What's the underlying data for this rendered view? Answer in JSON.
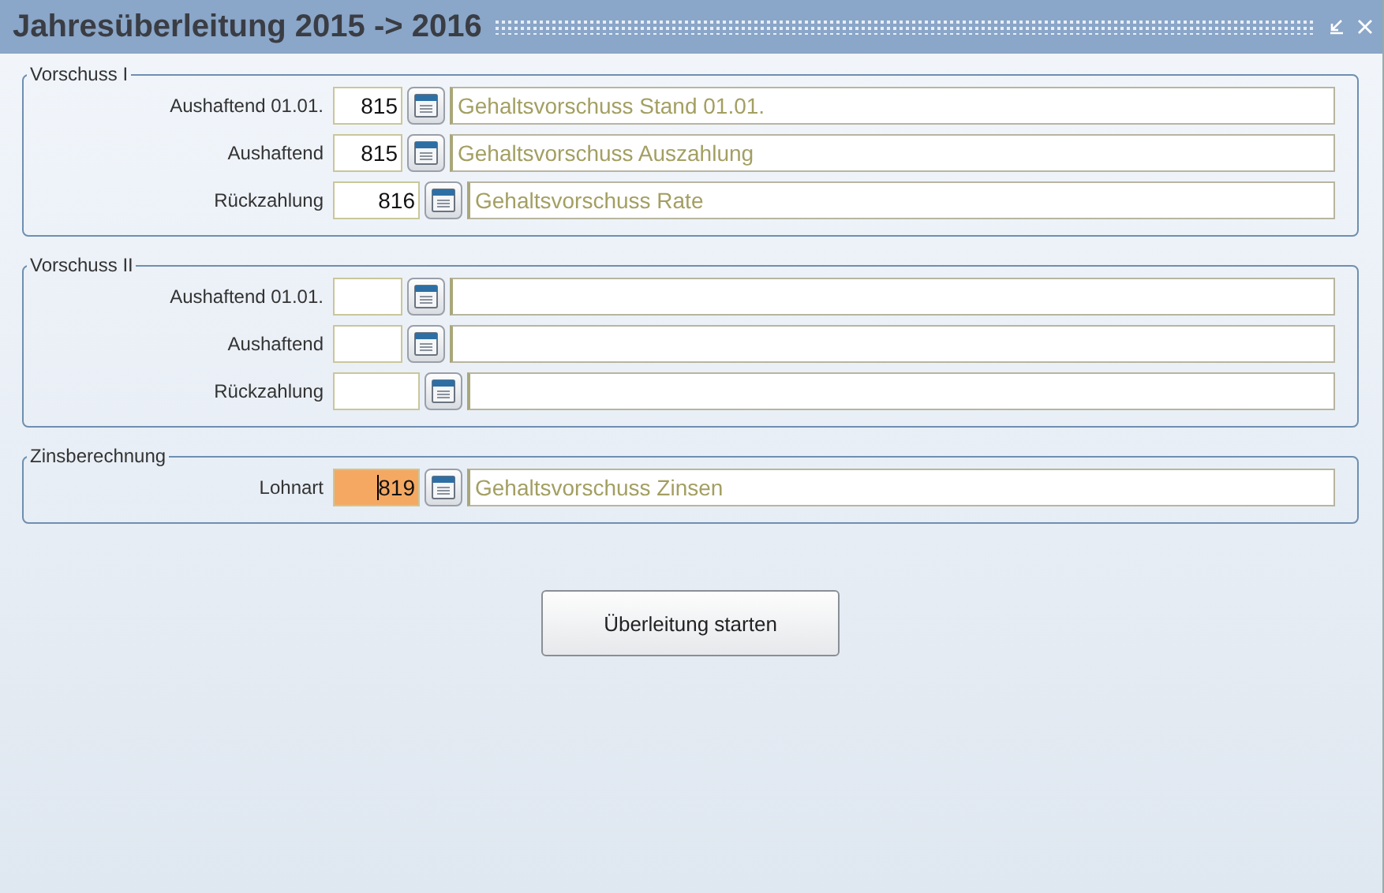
{
  "window": {
    "title": "Jahresüberleitung 2015 -> 2016"
  },
  "groups": [
    {
      "title": "Vorschuss I",
      "rows": [
        {
          "label": "Aushaftend 01.01.",
          "kind": "short",
          "code": "815",
          "focused": false,
          "description": "Gehaltsvorschuss Stand 01.01."
        },
        {
          "label": "Aushaftend",
          "kind": "short",
          "code": "815",
          "focused": false,
          "description": "Gehaltsvorschuss Auszahlung"
        },
        {
          "label": "Rückzahlung",
          "kind": "long",
          "code": "816",
          "focused": false,
          "description": "Gehaltsvorschuss Rate"
        }
      ]
    },
    {
      "title": "Vorschuss II",
      "rows": [
        {
          "label": "Aushaftend 01.01.",
          "kind": "short",
          "focused": false
        },
        {
          "label": "Aushaftend",
          "kind": "short",
          "focused": false
        },
        {
          "label": "Rückzahlung",
          "kind": "long",
          "focused": false
        }
      ]
    },
    {
      "title": "Zinsberechnung",
      "rows": [
        {
          "label": "Lohnart",
          "kind": "long",
          "code": "819",
          "focused": true,
          "description": "Gehaltsvorschuss Zinsen"
        }
      ]
    }
  ],
  "buttons": [
    {
      "label": "Überleitung starten"
    }
  ]
}
